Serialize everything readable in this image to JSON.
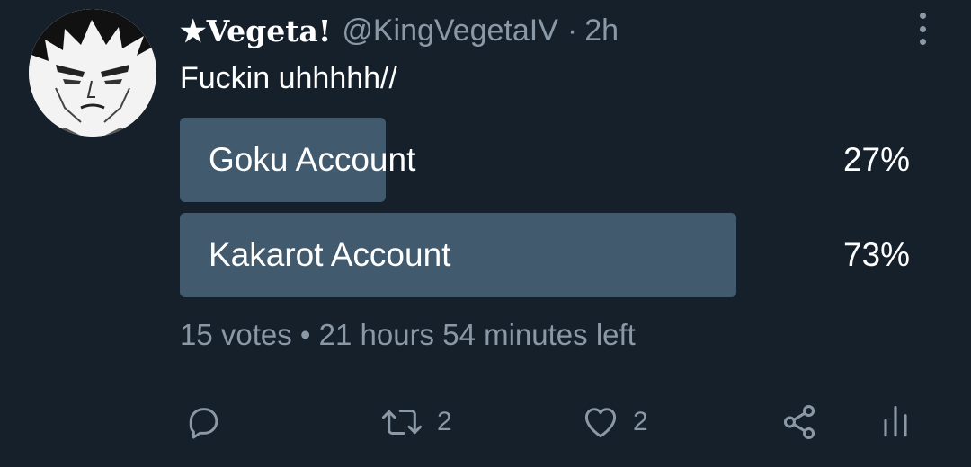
{
  "tweet": {
    "display_name": "★Vegeta!",
    "handle": "@KingVegetaIV",
    "separator": "·",
    "time": "2h",
    "text": "Fuckin uhhhhh//"
  },
  "poll": {
    "options": [
      {
        "label": "Goku Account",
        "percent": "27%",
        "fraction": 0.27
      },
      {
        "label": "Kakarot Account",
        "percent": "73%",
        "fraction": 0.73
      }
    ],
    "meta": "15 votes • 21 hours 54 minutes left",
    "colors": {
      "bar": "#425a6d",
      "background": "#15202b",
      "muted": "#8b98a5"
    }
  },
  "actions": {
    "reply_icon": "reply-icon",
    "retweet_icon": "retweet-icon",
    "retweet_count": "2",
    "like_icon": "heart-icon",
    "like_count": "2",
    "share_icon": "share-icon",
    "analytics_icon": "analytics-icon"
  }
}
